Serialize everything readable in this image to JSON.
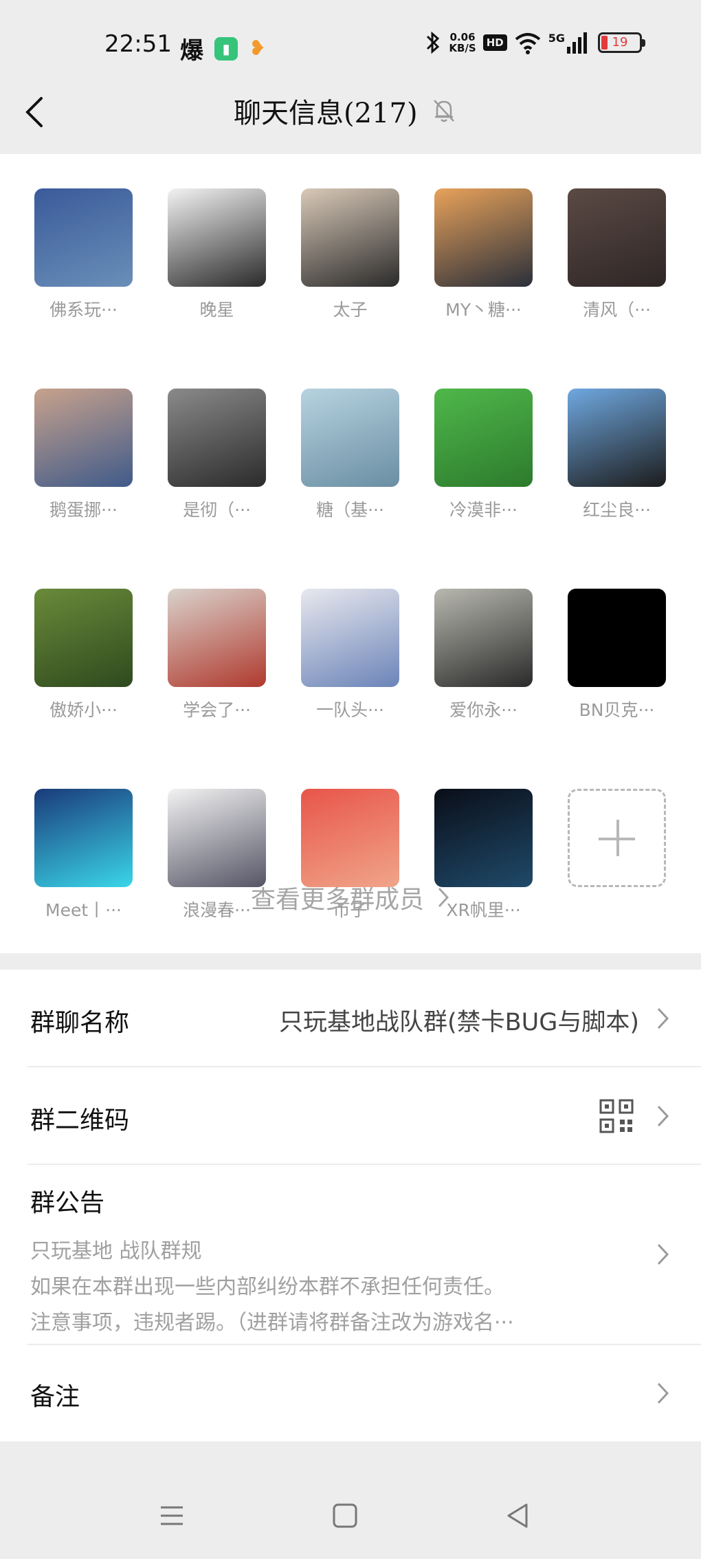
{
  "status_bar": {
    "time": "22:51",
    "icons": [
      "explosion-icon",
      "battery-app-icon",
      "heart-icon"
    ],
    "network_speed_value": "0.06",
    "network_speed_unit": "KB/S",
    "hd_label": "HD",
    "signal_label": "5G",
    "battery_level": "19",
    "battery_color": "#e23b3b"
  },
  "header": {
    "title": "聊天信息(217)",
    "mute_icon": "bell-off-icon"
  },
  "members": {
    "items": [
      {
        "name": "佛系玩···",
        "colors": [
          "#3a5a9a",
          "#6a8fb8"
        ]
      },
      {
        "name": "晚星",
        "colors": [
          "#f3f3f3",
          "#2a2a2a"
        ]
      },
      {
        "name": "太子",
        "colors": [
          "#d9c9b8",
          "#2b2b2b"
        ]
      },
      {
        "name": "MY丶糖···",
        "colors": [
          "#e8a25a",
          "#2a2f3a"
        ]
      },
      {
        "name": "清风（···",
        "colors": [
          "#5b4a44",
          "#2e2626"
        ]
      },
      {
        "name": "鹅蛋挪···",
        "colors": [
          "#c8a28c",
          "#3f5a8a"
        ]
      },
      {
        "name": "是彻（···",
        "colors": [
          "#8a8a8a",
          "#2b2b2b"
        ]
      },
      {
        "name": "糖（基···",
        "colors": [
          "#b7d3e0",
          "#6a8ea3"
        ]
      },
      {
        "name": "冷漠非···",
        "colors": [
          "#4fb84a",
          "#2d7a2d"
        ]
      },
      {
        "name": "红尘良···",
        "colors": [
          "#6fa8e0",
          "#1c1c1c"
        ]
      },
      {
        "name": "傲娇小···",
        "colors": [
          "#6a8a3a",
          "#2e4a1e"
        ]
      },
      {
        "name": "学会了···",
        "colors": [
          "#d9d2cc",
          "#b03a2e"
        ]
      },
      {
        "name": "一队头···",
        "colors": [
          "#e8e8ee",
          "#6b84b8"
        ]
      },
      {
        "name": "爱你永···",
        "colors": [
          "#b8b8b0",
          "#2a2a2a"
        ]
      },
      {
        "name": "BN贝克···",
        "colors": [
          "#000000",
          "#000000"
        ]
      },
      {
        "name": "Meet丨···",
        "colors": [
          "#1a3a7a",
          "#3ad6e8"
        ]
      },
      {
        "name": "浪漫春···",
        "colors": [
          "#f2f2f2",
          "#555566"
        ]
      },
      {
        "name": "帀子",
        "colors": [
          "#e8554a",
          "#f0a58a"
        ]
      },
      {
        "name": "XR帆里···",
        "colors": [
          "#0a0e18",
          "#1f4a6a"
        ]
      }
    ],
    "add_button_icon": "plus-icon",
    "more_label": "查看更多群成员"
  },
  "settings": {
    "group_name_label": "群聊名称",
    "group_name_value": "只玩基地战队群(禁卡BUG与脚本)",
    "qr_label": "群二维码",
    "qr_icon": "qr-code-icon",
    "notice_label": "群公告",
    "notice_lines": [
      "只玩基地 战队群规",
      "如果在本群出现一些内部纠纷本群不承担任何责任。",
      "注意事项，违规者踢。（进群请将群备注改为游戏名···"
    ],
    "remark_label": "备注"
  },
  "system_nav": {
    "menu_icon": "menu-icon",
    "home_icon": "home-square-icon",
    "back_icon": "back-triangle-icon"
  }
}
